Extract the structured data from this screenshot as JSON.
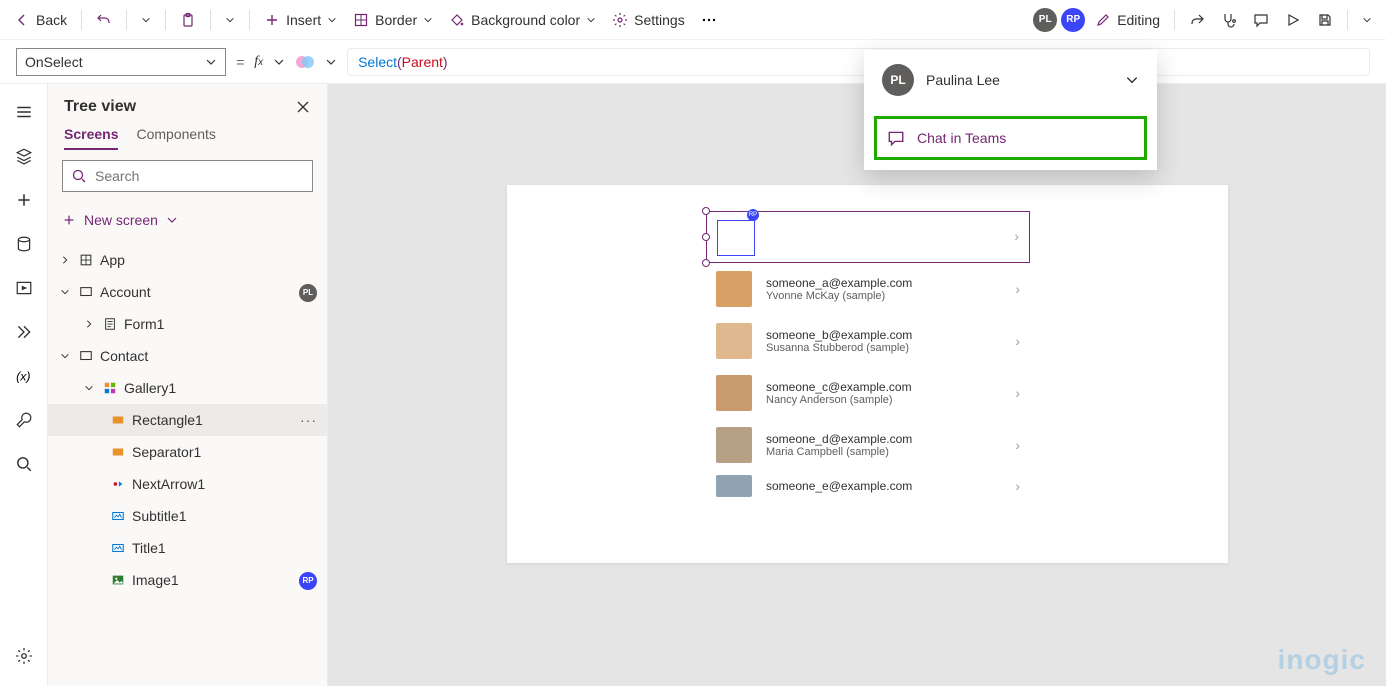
{
  "cmdbar": {
    "back": "Back",
    "insert": "Insert",
    "border": "Border",
    "bgcolor": "Background color",
    "settings": "Settings",
    "editing": "Editing"
  },
  "avatars": {
    "pl": "PL",
    "rp": "RP"
  },
  "formula": {
    "property": "OnSelect",
    "fn": "Select",
    "open": "(",
    "arg": "Parent",
    "close": ")"
  },
  "tree": {
    "title": "Tree view",
    "tabs": {
      "screens": "Screens",
      "components": "Components"
    },
    "searchPlaceholder": "Search",
    "newScreen": "New screen",
    "items": {
      "app": "App",
      "account": "Account",
      "form1": "Form1",
      "contact": "Contact",
      "gallery1": "Gallery1",
      "rectangle1": "Rectangle1",
      "separator1": "Separator1",
      "nextarrow1": "NextArrow1",
      "subtitle1": "Subtitle1",
      "title1": "Title1",
      "image1": "Image1"
    }
  },
  "popup": {
    "name": "Paulina Lee",
    "chat": "Chat in Teams"
  },
  "rows": [
    {
      "email": "someone_a@example.com",
      "name": "Yvonne McKay (sample)"
    },
    {
      "email": "someone_b@example.com",
      "name": "Susanna Stubberod (sample)"
    },
    {
      "email": "someone_c@example.com",
      "name": "Nancy Anderson (sample)"
    },
    {
      "email": "someone_d@example.com",
      "name": "Maria Campbell (sample)"
    },
    {
      "email": "someone_e@example.com",
      "name": ""
    }
  ],
  "watermark": "inogic"
}
